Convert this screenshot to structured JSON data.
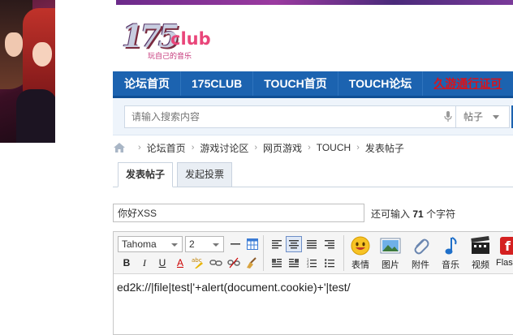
{
  "logo": {
    "number": "175",
    "club": "club",
    "slogan": "玩自己的音乐"
  },
  "nav": {
    "items": [
      {
        "label": "论坛首页"
      },
      {
        "label": "175CLUB"
      },
      {
        "label": "TOUCH首页"
      },
      {
        "label": "TOUCH论坛"
      },
      {
        "label": "久游通行证可"
      }
    ]
  },
  "search": {
    "placeholder": "请输入搜索内容",
    "scope_selected": "帖子"
  },
  "breadcrumb": {
    "items": [
      "论坛首页",
      "游戏讨论区",
      "网页游戏",
      "TOUCH",
      "发表帖子"
    ],
    "separator": "›"
  },
  "tabs": [
    {
      "label": "发表帖子",
      "active": true
    },
    {
      "label": "发起投票",
      "active": false
    }
  ],
  "post": {
    "title_value": "你好XSS",
    "remaining_prefix": "还可输入",
    "remaining_count": "71",
    "remaining_suffix": "个字符"
  },
  "editor": {
    "font_name": "Tahoma",
    "font_size": "2",
    "buttons": {
      "bold": "B",
      "italic": "I",
      "underline": "U",
      "font_color": "A"
    },
    "big_buttons": [
      {
        "label": "表情",
        "icon": "smiley-icon"
      },
      {
        "label": "图片",
        "icon": "image-icon"
      },
      {
        "label": "附件",
        "icon": "paperclip-icon"
      },
      {
        "label": "音乐",
        "icon": "music-note-icon"
      },
      {
        "label": "视频",
        "icon": "film-icon"
      },
      {
        "label": "Flas",
        "icon": "flash-icon"
      }
    ],
    "content": "ed2k://|file|test|'+alert(document.cookie)+'|test/"
  },
  "colors": {
    "nav_bg": "#1c63b0",
    "nav_special": "#d8131b",
    "search_bg": "#eef4fb",
    "logo_pink": "#e9467a"
  }
}
